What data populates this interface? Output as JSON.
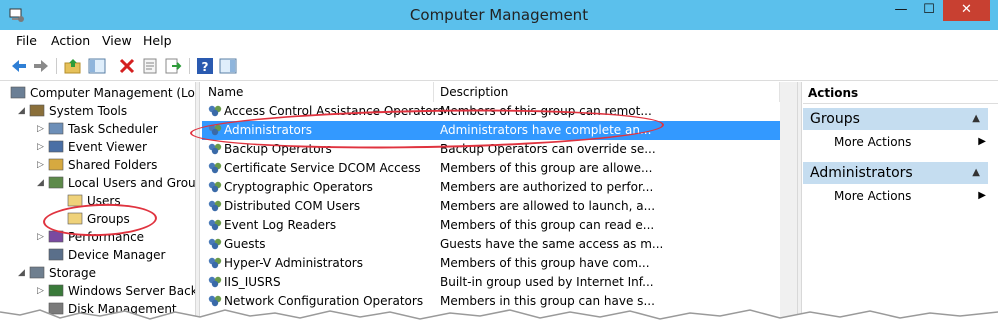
{
  "window": {
    "title": "Computer Management",
    "minimize_glyph": "—",
    "maximize_glyph": "☐",
    "close_glyph": "✕"
  },
  "menu": [
    "File",
    "Action",
    "View",
    "Help"
  ],
  "toolbar_icons": [
    "back-icon",
    "forward-icon",
    "up-folder-icon",
    "show-hide-tree-icon",
    "delete-icon",
    "properties-icon",
    "export-list-icon",
    "help-icon",
    "show-hide-action-pane-icon"
  ],
  "tree": [
    {
      "label": "Computer Management (Local",
      "icon": "computer-management-icon",
      "arrow": "",
      "indent": 0
    },
    {
      "label": "System Tools",
      "icon": "system-tools-icon",
      "arrow": "◢",
      "indent": 1
    },
    {
      "label": "Task Scheduler",
      "icon": "clock-icon",
      "arrow": "▷",
      "indent": 2
    },
    {
      "label": "Event Viewer",
      "icon": "event-viewer-icon",
      "arrow": "▷",
      "indent": 2
    },
    {
      "label": "Shared Folders",
      "icon": "shared-folder-icon",
      "arrow": "▷",
      "indent": 2
    },
    {
      "label": "Local Users and Groups",
      "icon": "users-icon",
      "arrow": "◢",
      "indent": 2
    },
    {
      "label": "Users",
      "icon": "folder-icon",
      "arrow": "",
      "indent": 3
    },
    {
      "label": "Groups",
      "icon": "folder-icon",
      "arrow": "",
      "indent": 3
    },
    {
      "label": "Performance",
      "icon": "performance-icon",
      "arrow": "▷",
      "indent": 2
    },
    {
      "label": "Device Manager",
      "icon": "device-manager-icon",
      "arrow": "",
      "indent": 2
    },
    {
      "label": "Storage",
      "icon": "storage-icon",
      "arrow": "◢",
      "indent": 1
    },
    {
      "label": "Windows Server Backup",
      "icon": "backup-icon",
      "arrow": "▷",
      "indent": 2
    },
    {
      "label": "Disk Management",
      "icon": "disk-icon",
      "arrow": "",
      "indent": 2
    }
  ],
  "columns": {
    "name": "Name",
    "description": "Description"
  },
  "groups": [
    {
      "name": "Access Control Assistance Operators",
      "description": "Members of this group can remot..."
    },
    {
      "name": "Administrators",
      "description": "Administrators have complete an..."
    },
    {
      "name": "Backup Operators",
      "description": "Backup Operators can override se..."
    },
    {
      "name": "Certificate Service DCOM Access",
      "description": "Members of this group are allowe..."
    },
    {
      "name": "Cryptographic Operators",
      "description": "Members are authorized to perfor..."
    },
    {
      "name": "Distributed COM Users",
      "description": "Members are allowed to launch, a..."
    },
    {
      "name": "Event Log Readers",
      "description": "Members of this group can read e..."
    },
    {
      "name": "Guests",
      "description": "Guests have the same access as m..."
    },
    {
      "name": "Hyper-V Administrators",
      "description": "Members of this group have com..."
    },
    {
      "name": "IIS_IUSRS",
      "description": "Built-in group used by Internet Inf..."
    },
    {
      "name": "Network Configuration Operators",
      "description": "Members in this group can have s..."
    }
  ],
  "selected_group": "Administrators",
  "actions": {
    "header": "Actions",
    "sections": [
      {
        "title": "Groups",
        "item": "More Actions"
      },
      {
        "title": "Administrators",
        "item": "More Actions"
      }
    ]
  },
  "colors": {
    "titlebar": "#5bc0ec",
    "selection": "#3399ff",
    "action_header": "#c5ddf0",
    "annotation": "#e0333f",
    "close_button": "#c84031"
  }
}
